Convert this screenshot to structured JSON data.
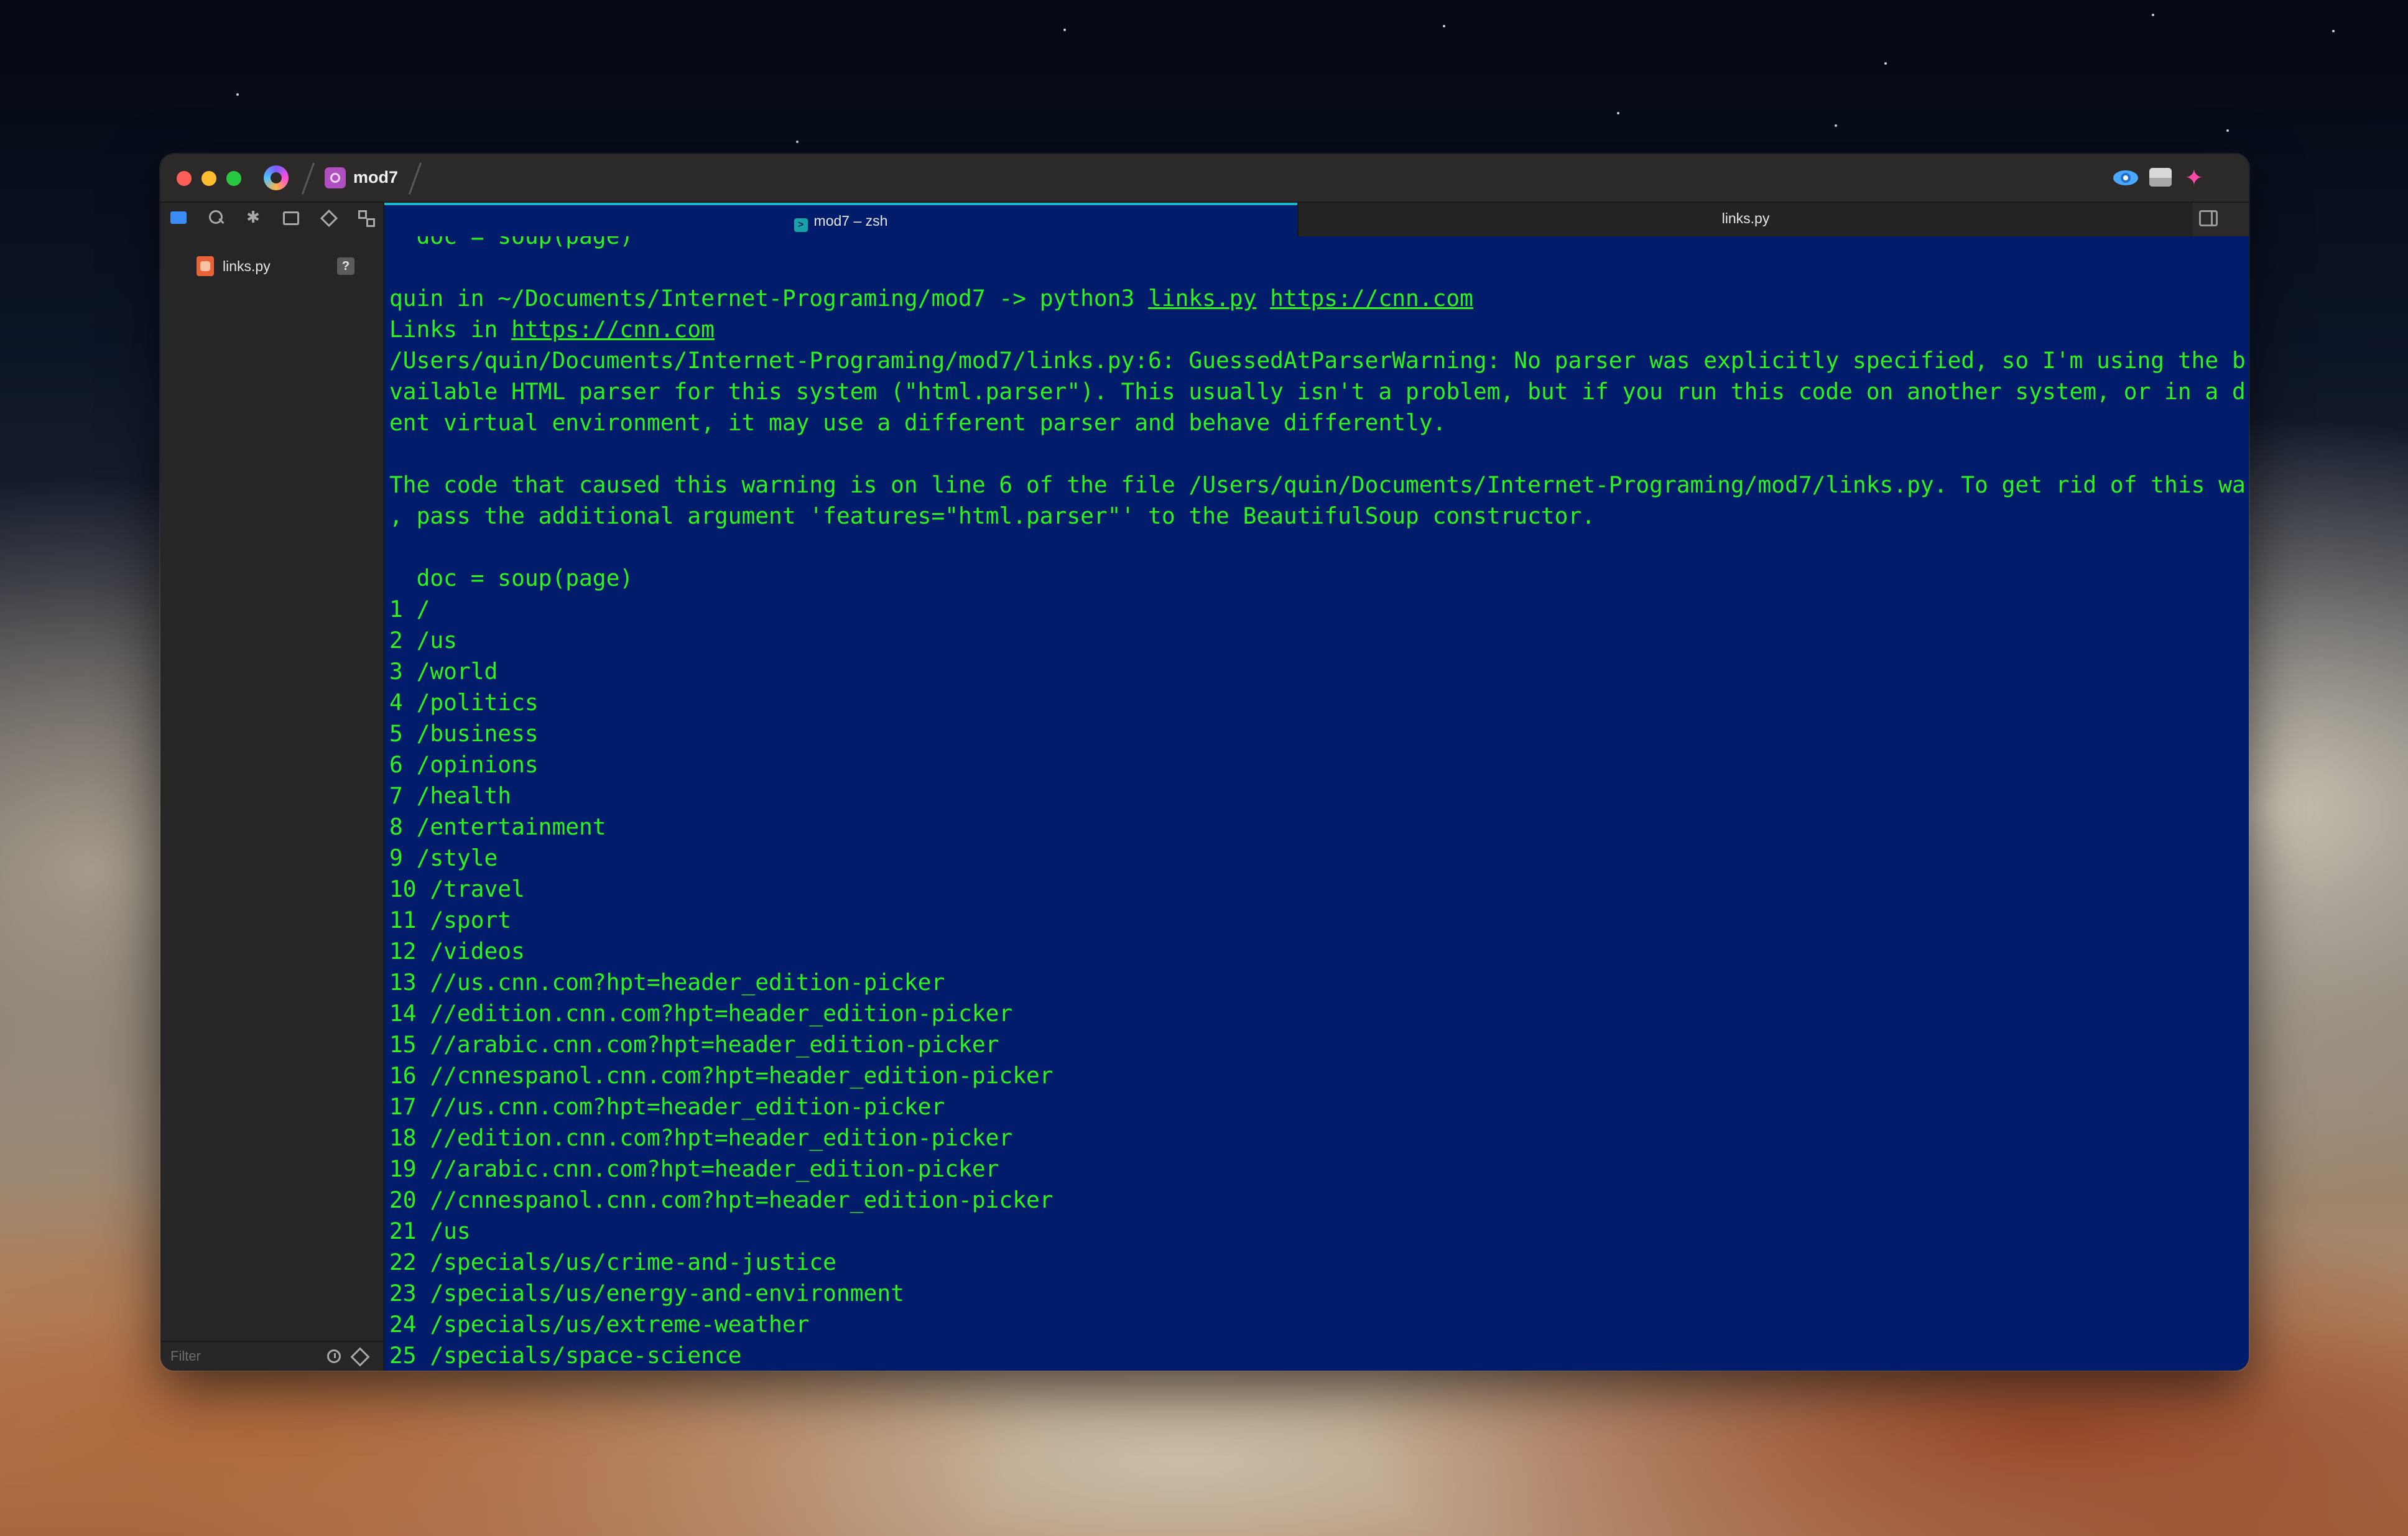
{
  "window": {
    "project_title": "mod7"
  },
  "titlebar_icons": [
    "app-logo-icon",
    "project-icon",
    "eye-icon",
    "panel-icon",
    "sparkle-icon"
  ],
  "sidebar": {
    "tools": [
      "folder-icon",
      "search-icon",
      "asterisk-icon",
      "rectangle-icon",
      "diamond-icon",
      "grid-icon"
    ],
    "file": {
      "name": "links.py",
      "badge": "?"
    },
    "filter_placeholder": "Filter"
  },
  "tabs": [
    {
      "label": "mod7 – zsh",
      "icon": "terminal-icon",
      "active": true
    },
    {
      "label": "links.py",
      "active": false
    }
  ],
  "terminal": {
    "colors": {
      "background": "#001c6b",
      "text": "#2ef21e",
      "accent": "#19b6c9"
    },
    "lines": [
      "  doc = soup(page)",
      "",
      "quin in ~/Documents/Internet-Programing/mod7 -> python3 links.py https://cnn.com",
      "Links in https://cnn.com",
      "/Users/quin/Documents/Internet-Programing/mod7/links.py:6: GuessedAtParserWarning: No parser was explicitly specified, so I'm using the best a",
      "vailable HTML parser for this system (\"html.parser\"). This usually isn't a problem, but if you run this code on another system, or in a differ",
      "ent virtual environment, it may use a different parser and behave differently.",
      "",
      "The code that caused this warning is on line 6 of the file /Users/quin/Documents/Internet-Programing/mod7/links.py. To get rid of this warning",
      ", pass the additional argument 'features=\"html.parser\"' to the BeautifulSoup constructor.",
      "",
      "  doc = soup(page)",
      "1 /",
      "2 /us",
      "3 /world",
      "4 /politics",
      "5 /business",
      "6 /opinions",
      "7 /health",
      "8 /entertainment",
      "9 /style",
      "10 /travel",
      "11 /sport",
      "12 /videos",
      "13 //us.cnn.com?hpt=header_edition-picker",
      "14 //edition.cnn.com?hpt=header_edition-picker",
      "15 //arabic.cnn.com?hpt=header_edition-picker",
      "16 //cnnespanol.cnn.com?hpt=header_edition-picker",
      "17 //us.cnn.com?hpt=header_edition-picker",
      "18 //edition.cnn.com?hpt=header_edition-picker",
      "19 //arabic.cnn.com?hpt=header_edition-picker",
      "20 //cnnespanol.cnn.com?hpt=header_edition-picker",
      "21 /us",
      "22 /specials/us/crime-and-justice",
      "23 /specials/us/energy-and-environment",
      "24 /specials/us/extreme-weather",
      "25 /specials/space-science"
    ],
    "underlined_words": [
      "links.py",
      "https://cnn.com"
    ]
  }
}
